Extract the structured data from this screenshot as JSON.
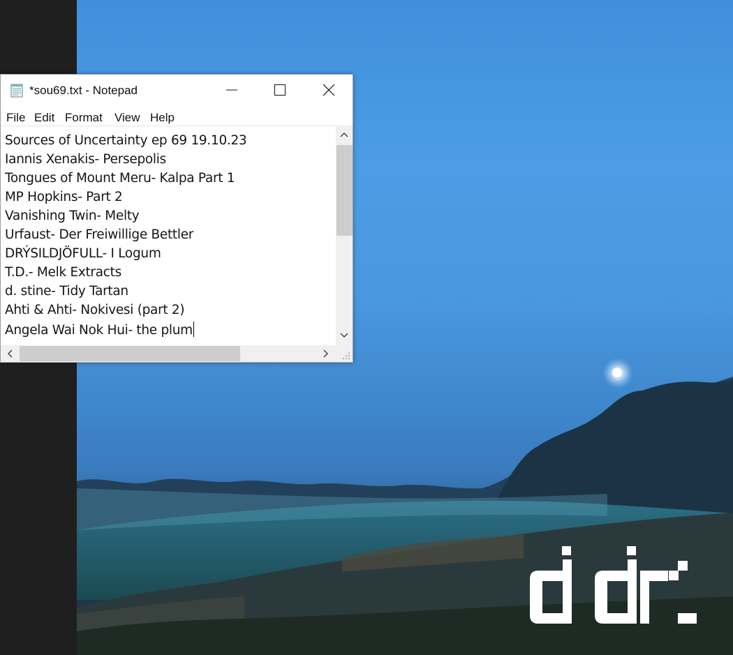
{
  "window": {
    "title": "*sou69.txt - Notepad"
  },
  "menu": [
    "File",
    "Edit",
    "Format",
    "View",
    "Help"
  ],
  "document": {
    "lines": [
      "Sources of Uncertainty ep 69 19.10.23",
      "Iannis Xenakis- Persepolis",
      "Tongues of Mount Meru- Kalpa Part 1",
      "MP Hopkins- Part 2",
      "Vanishing Twin- Melty",
      "Urfaust- Der Freiwillige Bettler",
      "DRÝSILDJÖFULL- I Logum",
      "T.D.- Melk Extracts",
      "d. stine- Tidy Tartan",
      "Ahti & Ahti- Nokivesi (part 2)",
      "Angela Wai Nok Hui- the plum"
    ]
  },
  "icons": {
    "app": "notepad-icon",
    "minimize": "minimize-icon",
    "maximize": "maximize-icon",
    "close": "close-icon"
  },
  "wallpaper": {
    "logo_text": "ddr"
  },
  "colors": {
    "sky": "#4c9de6",
    "left_strip": "#1f1f1f",
    "scroll_thumb": "#cdcdcd"
  }
}
